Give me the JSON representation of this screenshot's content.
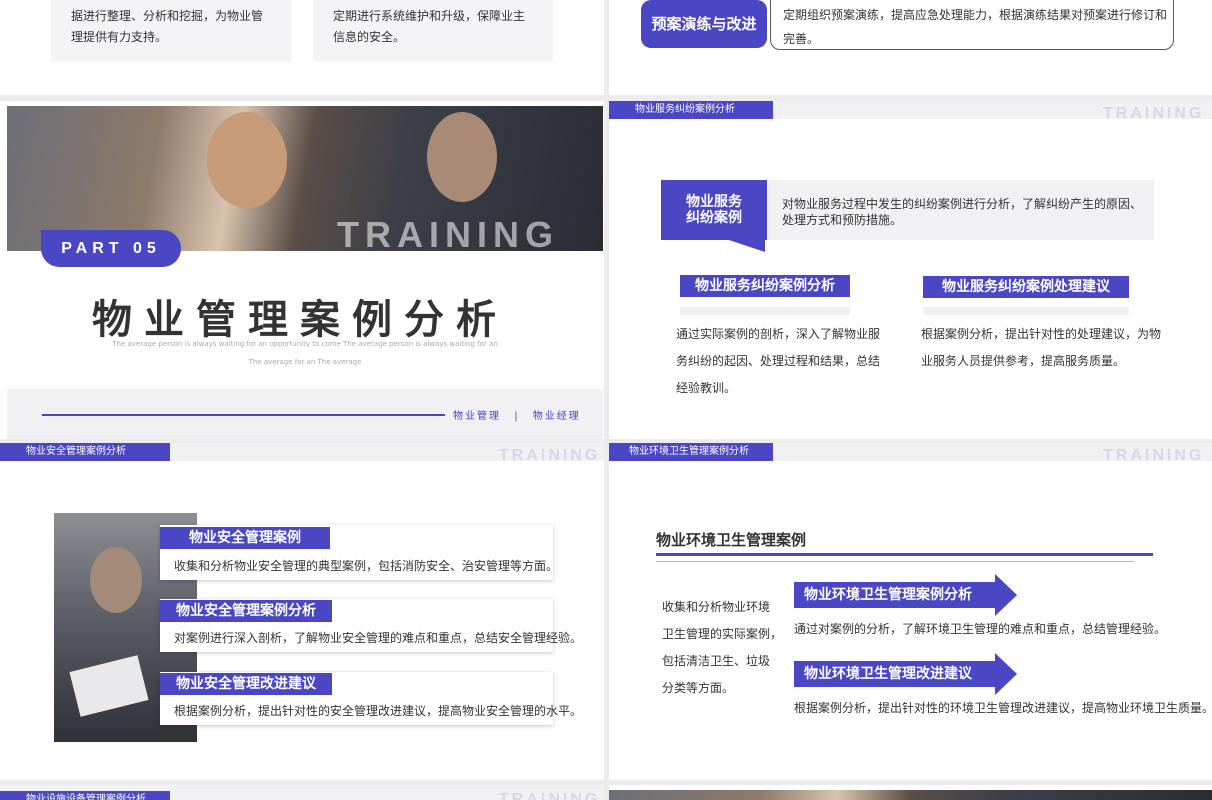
{
  "slide_top_left": {
    "card1_lines": [
      "据进行整理、分析和挖掘，为物业管",
      "理提供有力支持。"
    ],
    "card2_lines": [
      "定期进行系统维护和升级，保障业主",
      "信息的安全。"
    ]
  },
  "slide_top_right": {
    "button_label": "预案演练与改进",
    "desc": "定期组织预案演练，提高应急处理能力，根据演练结果对预案进行修订和完善。"
  },
  "slide_cover": {
    "photo_text": "TRAINING",
    "part_label": "PART 05",
    "title": "物业管理案例分析",
    "subtitle_line1": "The average person is always waiting for an opportunity to come The average person is always waiting for an",
    "subtitle_line2": "The average for an The average",
    "footer_tag1": "物业管理",
    "footer_sep": "|",
    "footer_tag2": "物业经理"
  },
  "slide_dispute": {
    "header": "物业服务纠纷案例分析",
    "watermark": "TRAINING",
    "tag_line1": "物业服务",
    "tag_line2": "纠纷案例",
    "intro_line1": "对物业服务过程中发生的纠纷案例进行分析，了解纠纷产生的原因、",
    "intro_line2": "处理方式和预防措施。",
    "left_title": "物业服务纠纷案例分析",
    "left_lines": [
      "通过实际案例的剖析，深入了解物业服",
      "务纠纷的起因、处理过程和结果，总结",
      "经验教训。"
    ],
    "right_title": "物业服务纠纷案例处理建议",
    "right_lines": [
      "根据案例分析，提出针对性的处理建议，为物",
      "业服务人员提供参考，提高服务质量。"
    ]
  },
  "slide_security": {
    "header": "物业安全管理案例分析",
    "watermark": "TRAINING",
    "items": [
      {
        "title": "物业安全管理案例",
        "text": "收集和分析物业安全管理的典型案例，包括消防安全、治安管理等方面。"
      },
      {
        "title": "物业安全管理案例分析",
        "text": "对案例进行深入剖析，了解物业安全管理的难点和重点，总结安全管理经验。"
      },
      {
        "title": "物业安全管理改进建议",
        "text": "根据案例分析，提出针对性的安全管理改进建议，提高物业安全管理的水平。"
      }
    ]
  },
  "slide_env": {
    "header": "物业环境卫生管理案例分析",
    "watermark": "TRAINING",
    "title": "物业环境卫生管理案例",
    "left_lines": [
      "收集和分析物业环境",
      "卫生管理的实际案例，",
      "包括清洁卫生、垃圾",
      "分类等方面。"
    ],
    "item1_title": "物业环境卫生管理案例分析",
    "item1_text": "通过对案例的分析，了解环境卫生管理的难点和重点，总结管理经验。",
    "item2_title": "物业环境卫生管理改进建议",
    "item2_text": "根据案例分析，提出针对性的环境卫生管理改进建议，提高物业环境卫生质量。"
  },
  "slide_bottom_left": {
    "header": "物业设施设备管理案例分析",
    "watermark": "TRAINING"
  },
  "colors": {
    "accent": "#4a46c4",
    "panel": "#f1f1f3"
  }
}
